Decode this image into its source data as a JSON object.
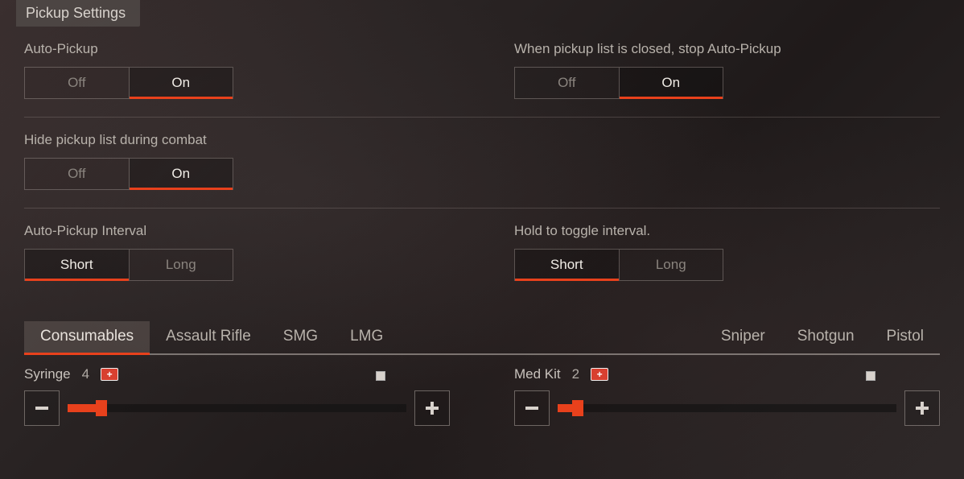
{
  "header": {
    "title": "Pickup Settings"
  },
  "settings": {
    "autoPickup": {
      "label": "Auto-Pickup",
      "options": [
        "Off",
        "On"
      ],
      "active": 1
    },
    "stopWhenClosed": {
      "label": "When pickup list is closed, stop Auto-Pickup",
      "options": [
        "Off",
        "On"
      ],
      "active": 1
    },
    "hideInCombat": {
      "label": "Hide pickup list during combat",
      "options": [
        "Off",
        "On"
      ],
      "active": 1
    },
    "interval": {
      "label": "Auto-Pickup Interval",
      "options": [
        "Short",
        "Long"
      ],
      "active": 0
    },
    "holdToggle": {
      "label": "Hold to toggle interval.",
      "options": [
        "Short",
        "Long"
      ],
      "active": 0
    }
  },
  "tabs": [
    "Consumables",
    "Assault Rifle",
    "SMG",
    "LMG",
    "Sniper",
    "Shotgun",
    "Pistol"
  ],
  "activeTab": 0,
  "items": {
    "syringe": {
      "name": "Syringe",
      "count": "4",
      "fillPercent": 10
    },
    "medkit": {
      "name": "Med Kit",
      "count": "2",
      "fillPercent": 6
    }
  },
  "colors": {
    "accent": "#e8411c"
  }
}
